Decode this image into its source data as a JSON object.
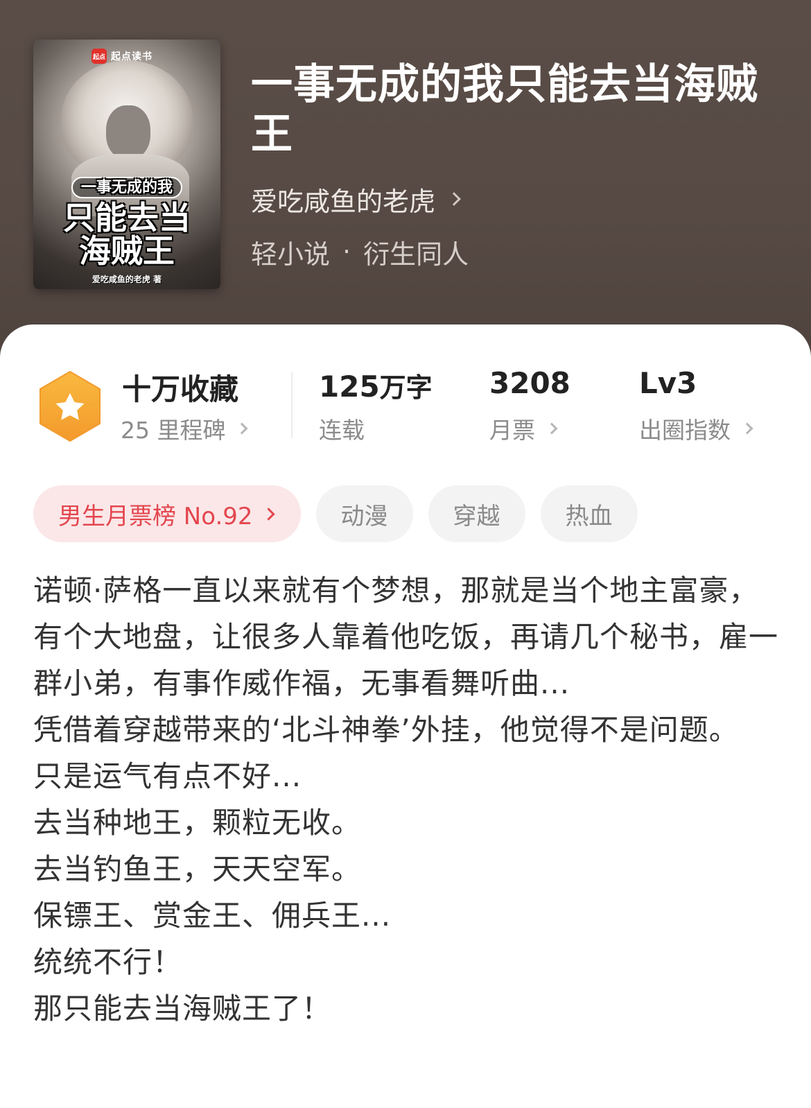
{
  "book": {
    "cover": {
      "badge": "起点读书",
      "badge_logo": "起点",
      "title_line1": "一事无成的我",
      "title_line2": "只能去当",
      "title_line3": "海贼王",
      "author": "爱吃咸鱼的老虎 著"
    },
    "title": "一事无成的我只能去当海贼王",
    "author": "爱吃咸鱼的老虎",
    "genre": "轻小说",
    "genre_separator": "·",
    "subgenre": "衍生同人"
  },
  "stats": [
    {
      "main": "十万收藏",
      "sub": "25 里程碑"
    },
    {
      "main_number": "125",
      "main_unit": "万字",
      "sub": "连载"
    },
    {
      "main": "3208",
      "sub": "月票"
    },
    {
      "main": "Lv3",
      "sub": "出圈指数"
    }
  ],
  "tags": {
    "rank": "男生月票榜 No.92",
    "items": [
      "动漫",
      "穿越",
      "热血"
    ]
  },
  "synopsis": [
    "诺顿·萨格一直以来就有个梦想，那就是当个地主富豪，有个大地盘，让很多人靠着他吃饭，再请几个秘书，雇一群小弟，有事作威作福，无事看舞听曲...",
    "凭借着穿越带来的‘北斗神拳’外挂，他觉得不是问题。",
    "只是运气有点不好...",
    "去当种地王，颗粒无收。",
    "去当钓鱼王，天天空军。",
    "保镖王、赏金王、佣兵王...",
    "统统不行！",
    "那只能去当海贼王了！"
  ],
  "colors": {
    "header_bg": "#574a44",
    "accent_red": "#e3464e",
    "badge_orange": "#f6a53a"
  }
}
